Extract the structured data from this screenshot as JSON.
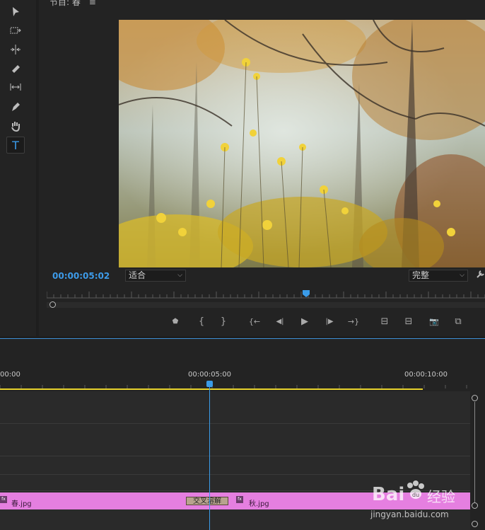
{
  "tools": [
    {
      "name": "selection-tool-icon"
    },
    {
      "name": "track-select-tool-icon"
    },
    {
      "name": "ripple-edit-tool-icon"
    },
    {
      "name": "razor-tool-icon"
    },
    {
      "name": "slip-tool-icon"
    },
    {
      "name": "pen-tool-icon"
    },
    {
      "name": "hand-tool-icon"
    },
    {
      "name": "type-tool-icon",
      "glyph": "T",
      "active": true
    }
  ],
  "monitor": {
    "title": "节目: 春",
    "menu_glyph": "≡",
    "timecode": "00:00:05:02",
    "fit_select": "适合",
    "quality_select": "完整",
    "settings_glyph": "🔧"
  },
  "transport": {
    "marker": "⬟",
    "in": "{",
    "out": "}",
    "go_in": "{←",
    "step_back": "◀|",
    "play": "▶",
    "step_fwd": "|▶",
    "go_out": "→}",
    "insert": "⊟",
    "overwrite": "⊟",
    "export_frame": "📷",
    "compare": "⧉"
  },
  "timeline": {
    "tc_start": "00:00",
    "tc_mid": "00:00:05:00",
    "tc_end": "00:00:10:00",
    "clip1": "春.jpg",
    "clip2": "秋.jpg",
    "fx_label": "fx",
    "transition": "交叉溶解"
  },
  "watermark": {
    "brand": "Bai",
    "brand2": "经验",
    "url": "jingyan.baidu.com"
  },
  "colors": {
    "accent": "#3a9be8",
    "clip": "#e57fe0",
    "work_area": "#e6d12c"
  }
}
